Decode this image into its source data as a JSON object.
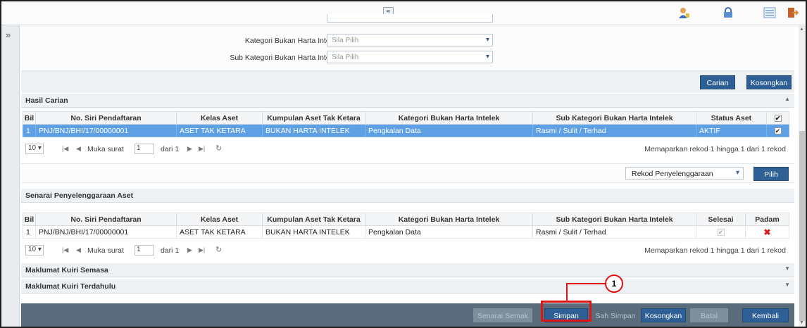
{
  "filters": [
    {
      "label": "Kategori Bukan Harta Intelek :",
      "placeholder": "Sila Pilih"
    },
    {
      "label": "Sub Kategori Bukan Harta Intelek :",
      "placeholder": "Sila Pilih"
    }
  ],
  "search_buttons": {
    "search": "Carian",
    "clear": "Kosongkan"
  },
  "results": {
    "title": "Hasil Carian",
    "columns": [
      "Bil",
      "No. Siri Pendaftaran",
      "Kelas Aset",
      "Kumpulan Aset Tak Ketara",
      "Kategori Bukan Harta Intelek",
      "Sub Kategori Bukan Harta Intelek",
      "Status Aset"
    ],
    "rows": [
      {
        "bil": "1",
        "no_siri": "PNJ/BNJ/BHI/17/00000001",
        "kelas": "ASET TAK KETARA",
        "kumpulan": "BUKAN HARTA INTELEK",
        "kategori": "Pengkalan Data",
        "sub": "Rasmi / Sulit / Terhad",
        "status": "AKTIF"
      }
    ],
    "pager": {
      "size": "10 ▾",
      "page_label": "Muka surat",
      "page": "1",
      "of": "dari 1",
      "info": "Memaparkan rekod 1 hingga 1 dari 1 rekod"
    }
  },
  "rekod": {
    "selected": "Rekod Penyelenggaraan",
    "button": "Pilih"
  },
  "maintenance": {
    "title": "Senarai Penyelenggaraan Aset",
    "columns": [
      "Bil",
      "No. Siri Pendaftaran",
      "Kelas Aset",
      "Kumpulan Aset Tak Ketara",
      "Kategori Bukan Harta Intelek",
      "Sub Kategori Bukan Harta Intelek",
      "Selesai",
      "Padam"
    ],
    "rows": [
      {
        "bil": "1",
        "no_siri": "PNJ/BNJ/BHI/17/00000001",
        "kelas": "ASET TAK KETARA",
        "kumpulan": "BUKAN HARTA INTELEK",
        "kategori": "Pengkalan Data",
        "sub": "Rasmi / Sulit / Terhad"
      }
    ],
    "pager": {
      "size": "10 ▾",
      "page_label": "Muka surat",
      "page": "1",
      "of": "dari 1",
      "info": "Memaparkan rekod 1 hingga 1 dari 1 rekod"
    }
  },
  "sections": {
    "current": "Maklumat Kuiri Semasa",
    "previous": "Maklumat Kuiri Terdahulu"
  },
  "footer": {
    "senarai_semak": "Senarai Semak",
    "simpan": "Simpan",
    "sah_simpan": "Sah Simpan",
    "kosongkan": "Kosongkan",
    "batal": "Batal",
    "kembali": "Kembali"
  },
  "callout": {
    "number": "1"
  },
  "colors": {
    "accent": "#2e5f95",
    "selection": "#5fa0e4",
    "callout": "#e01414",
    "footer": "#5a6c7c"
  },
  "icons": [
    "collapse-up-icon",
    "user-icon",
    "lock-icon",
    "list-icon",
    "logout-icon",
    "expand-sidebar-icon",
    "chevron-down-icon",
    "delete-icon",
    "refresh-icon"
  ]
}
